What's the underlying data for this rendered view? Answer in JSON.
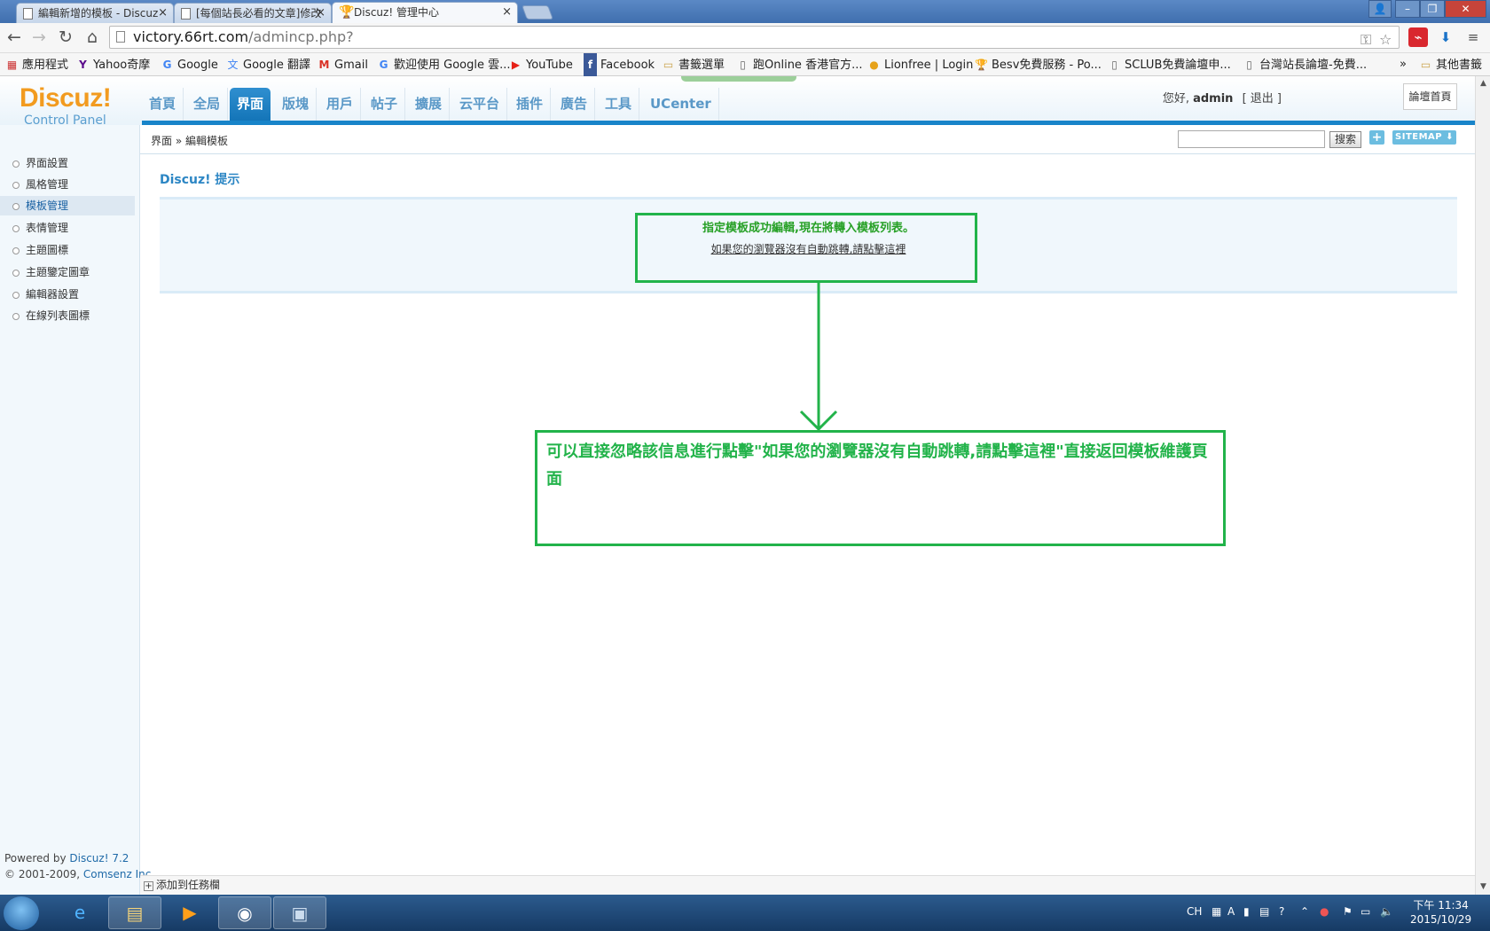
{
  "browser": {
    "tabs": [
      {
        "label": "編輯新增的模板 - Discuz"
      },
      {
        "label": "[每個站長必看的文章]修改"
      },
      {
        "label": "Discuz! 管理中心"
      }
    ],
    "close_glyph": "×",
    "url_host": "victory.66rt.com",
    "url_path": "/admincp.php?",
    "bookmarks": [
      {
        "label": "應用程式",
        "icon": "apps-grid-icon"
      },
      {
        "label": "Yahoo奇摩",
        "icon": "yahoo-icon"
      },
      {
        "label": "Google",
        "icon": "google-icon"
      },
      {
        "label": "Google 翻譯",
        "icon": "translate-icon"
      },
      {
        "label": "Gmail",
        "icon": "gmail-icon"
      },
      {
        "label": "歡迎使用 Google 雲...",
        "icon": "google-icon"
      },
      {
        "label": "YouTube",
        "icon": "youtube-icon"
      },
      {
        "label": "Facebook",
        "icon": "facebook-icon"
      },
      {
        "label": "書籤選單",
        "icon": "folder-icon"
      },
      {
        "label": "跑Online 香港官方...",
        "icon": "page-icon"
      },
      {
        "label": "Lionfree | Login",
        "icon": "lionfree-icon"
      },
      {
        "label": "Besv免費服務 - Po...",
        "icon": "trophy-icon"
      },
      {
        "label": "SCLUB免費論壇申...",
        "icon": "page-icon"
      },
      {
        "label": "台灣站長論壇-免費...",
        "icon": "page-icon"
      }
    ],
    "bookmarks_overflow": "»",
    "other_bookmarks": "其他書籤"
  },
  "header": {
    "logo": "Discuz!",
    "logo_sub": "Control Panel",
    "nav": [
      "首頁",
      "全局",
      "界面",
      "版塊",
      "用戶",
      "帖子",
      "擴展",
      "云平台",
      "插件",
      "廣告",
      "工具",
      "UCenter"
    ],
    "active_nav": "界面",
    "greeting": "您好,",
    "username": "admin",
    "logout": "[ 退出 ]",
    "forum_home": "論壇首頁"
  },
  "subbar": {
    "breadcrumb": "界面 » 編輯模板",
    "search_button": "搜索",
    "plus": "+",
    "sitemap": "SITEMAP ⬇"
  },
  "sidebar": {
    "items": [
      "界面設置",
      "風格管理",
      "模板管理",
      "表情管理",
      "主題圖標",
      "主題鑒定圖章",
      "編輯器設置",
      "在線列表圖標"
    ],
    "active_index": 2,
    "powered_prefix": "Powered by ",
    "powered_link": "Discuz! 7.2",
    "copyright_prefix": "© 2001-2009, ",
    "copyright_link": "Comsenz Inc."
  },
  "main": {
    "title": "Discuz! 提示",
    "success_message": "指定模板成功編輯,現在將轉入模板列表。",
    "redirect_link": "如果您的瀏覽器沒有自動跳轉,請點擊這裡"
  },
  "annotation": {
    "text": "可以直接忽略該信息進行點擊\"如果您的瀏覽器沒有自動跳轉,請點擊這裡\"直接返回模板維護頁面",
    "color": "#22b34a"
  },
  "statusbar": {
    "label": "添加到任務欄"
  },
  "taskbar": {
    "tray_lang": "CH",
    "time": "下午 11:34",
    "date": "2015/10/29"
  }
}
